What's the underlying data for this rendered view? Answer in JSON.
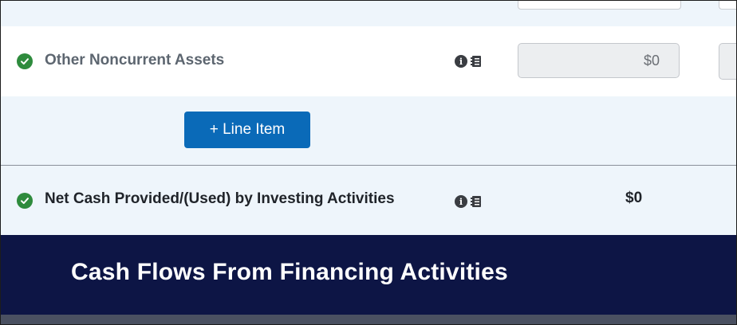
{
  "rows": {
    "other_noncurrent_assets": {
      "label": "Other Noncurrent Assets",
      "value": "$0",
      "status": "complete"
    },
    "add_line": {
      "button_label": "+ Line Item"
    },
    "net_investing": {
      "label": "Net Cash Provided/(Used) by Investing Activities",
      "value": "$0",
      "status": "complete"
    }
  },
  "section_header": {
    "title": "Cash Flows From Financing Activities"
  },
  "icons": {
    "status": "check-circle-icon",
    "info": "info-icon",
    "notes": "notes-icon"
  },
  "colors": {
    "check_green": "#2e8b3d",
    "button_blue": "#0a6ab8",
    "header_navy": "#0d1545",
    "row_tint": "#eef5fb"
  }
}
